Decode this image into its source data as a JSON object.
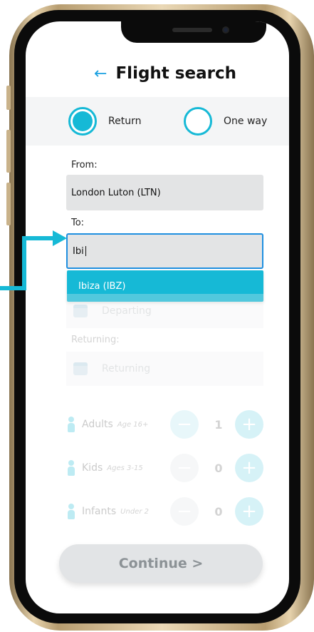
{
  "header": {
    "title": "Flight search",
    "back_icon": "left-arrow-icon"
  },
  "trip_type": {
    "options": [
      {
        "label": "Return",
        "selected": true
      },
      {
        "label": "One way",
        "selected": false
      }
    ]
  },
  "from": {
    "label": "From:",
    "value": "London Luton (LTN)"
  },
  "to": {
    "label": "To:",
    "value": "Ibi"
  },
  "suggestions": [
    "Ibiza (IBZ)"
  ],
  "departing": {
    "placeholder": "Departing"
  },
  "returning": {
    "label": "Returning:",
    "placeholder": "Returning"
  },
  "passengers": [
    {
      "label": "Adults",
      "sub": "Age 16+",
      "count": "1"
    },
    {
      "label": "Kids",
      "sub": "Ages 3-15",
      "count": "0"
    },
    {
      "label": "Infants",
      "sub": "Under 2",
      "count": "0"
    }
  ],
  "continue_label": "Continue >",
  "colors": {
    "accent": "#16b9d6",
    "focus": "#1f8fe0",
    "back": "#1aa0e0"
  }
}
